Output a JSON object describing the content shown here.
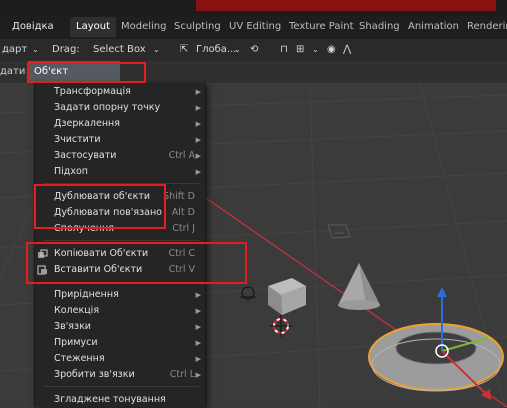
{
  "topbar": {
    "menu_help": "Довідка",
    "workspaces": [
      "Layout",
      "Modeling",
      "Sculpting",
      "UV Editing",
      "Texture Paint",
      "Shading",
      "Animation",
      "Rendering"
    ]
  },
  "toolbar": {
    "mode": "дарт",
    "drag_label": "Drag:",
    "drag_value": "Select Box",
    "orientation": "Глоба..."
  },
  "header": {
    "prev_menu": "дати",
    "object_menu": "Об'єкт"
  },
  "object_menu": {
    "items": [
      {
        "label": "Трансформація",
        "shortcut": "",
        "submenu": true
      },
      {
        "label": "Задати опорну точку",
        "shortcut": "",
        "submenu": true
      },
      {
        "label": "Дзеркалення",
        "shortcut": "",
        "submenu": true
      },
      {
        "label": "Зчистити",
        "shortcut": "",
        "submenu": true
      },
      {
        "label": "Застосувати",
        "shortcut": "Ctrl A",
        "submenu": true
      },
      {
        "label": "Підхоп",
        "shortcut": "",
        "submenu": true
      },
      {
        "label": "Дублювати об'єкти",
        "shortcut": "Shift D",
        "submenu": false
      },
      {
        "label": "Дублювати пов'язано",
        "shortcut": "Alt D",
        "submenu": false
      },
      {
        "label": "Сполучення",
        "shortcut": "Ctrl J",
        "submenu": false
      },
      {
        "label": "Копіювати Об'єкти",
        "shortcut": "Ctrl C",
        "submenu": false,
        "icon": "copy-icon"
      },
      {
        "label": "Вставити Об'єкти",
        "shortcut": "Ctrl V",
        "submenu": false,
        "icon": "paste-icon"
      },
      {
        "label": "Приріднення",
        "shortcut": "",
        "submenu": true
      },
      {
        "label": "Колекція",
        "shortcut": "",
        "submenu": true
      },
      {
        "label": "Зв'язки",
        "shortcut": "",
        "submenu": true
      },
      {
        "label": "Примуси",
        "shortcut": "",
        "submenu": true
      },
      {
        "label": "Стеження",
        "shortcut": "",
        "submenu": true
      },
      {
        "label": "Зробити зв'язки",
        "shortcut": "Ctrl L",
        "submenu": true
      },
      {
        "label": "Згладжене тонування",
        "shortcut": "",
        "submenu": false
      }
    ]
  },
  "colors": {
    "highlight_box": "#e51d1d",
    "x_axis": "#c8323c",
    "y_axis": "#7ab82e",
    "z_axis": "#2f6ed6",
    "selection_outline": "#f0a030"
  }
}
